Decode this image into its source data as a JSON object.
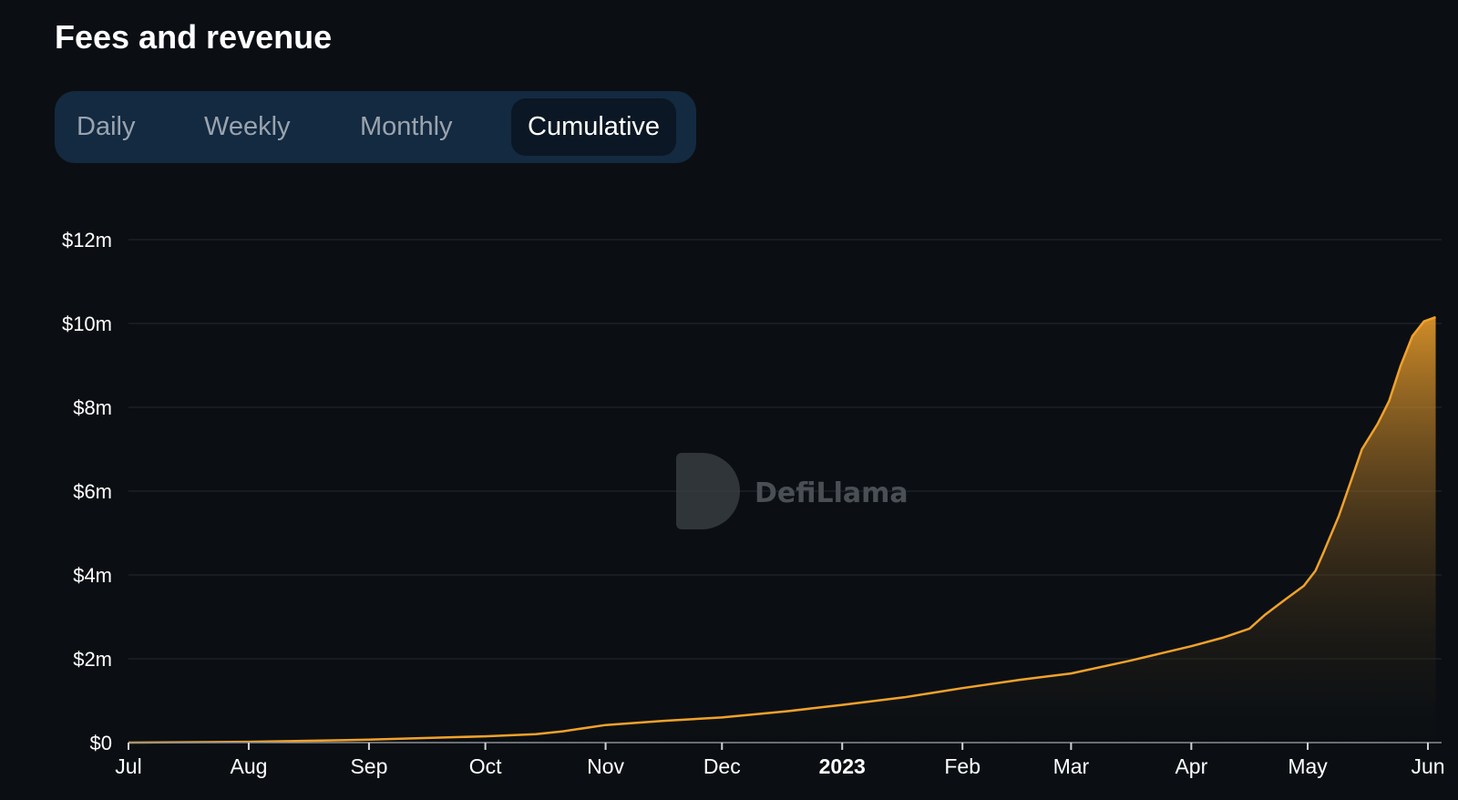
{
  "header": {
    "title": "Fees and revenue"
  },
  "tabs": [
    {
      "label": "Daily"
    },
    {
      "label": "Weekly"
    },
    {
      "label": "Monthly"
    },
    {
      "label": "Cumulative",
      "active": true
    }
  ],
  "watermark": "DefiLlama",
  "colors": {
    "line": "#f2a22b",
    "background": "#0b0f13",
    "tabs_bg": "#132a41"
  },
  "chart_data": {
    "type": "area",
    "title": "Fees and revenue",
    "series_mode": "Cumulative",
    "x_unit": "days since 2022-07-01",
    "y_unit": "USD millions",
    "ylim": [
      0,
      12
    ],
    "yticks": [
      {
        "v": 0,
        "label": "$0"
      },
      {
        "v": 2,
        "label": "$2m"
      },
      {
        "v": 4,
        "label": "$4m"
      },
      {
        "v": 6,
        "label": "$6m"
      },
      {
        "v": 8,
        "label": "$8m"
      },
      {
        "v": 10,
        "label": "$10m"
      },
      {
        "v": 12,
        "label": "$12m"
      }
    ],
    "xticks": [
      {
        "d": 0,
        "label": "Jul"
      },
      {
        "d": 31,
        "label": "Aug"
      },
      {
        "d": 62,
        "label": "Sep"
      },
      {
        "d": 92,
        "label": "Oct"
      },
      {
        "d": 123,
        "label": "Nov"
      },
      {
        "d": 153,
        "label": "Dec"
      },
      {
        "d": 184,
        "label": "2023",
        "bold": true
      },
      {
        "d": 215,
        "label": "Feb"
      },
      {
        "d": 243,
        "label": "Mar"
      },
      {
        "d": 274,
        "label": "Apr"
      },
      {
        "d": 304,
        "label": "May"
      },
      {
        "d": 335,
        "label": "Jun"
      }
    ],
    "grid": true,
    "points": [
      [
        0,
        0
      ],
      [
        31,
        0.02
      ],
      [
        62,
        0.07
      ],
      [
        92,
        0.15
      ],
      [
        105,
        0.2
      ],
      [
        112,
        0.27
      ],
      [
        123,
        0.42
      ],
      [
        138,
        0.52
      ],
      [
        153,
        0.6
      ],
      [
        170,
        0.75
      ],
      [
        184,
        0.9
      ],
      [
        200,
        1.08
      ],
      [
        215,
        1.3
      ],
      [
        230,
        1.5
      ],
      [
        243,
        1.65
      ],
      [
        258,
        1.95
      ],
      [
        274,
        2.3
      ],
      [
        282,
        2.5
      ],
      [
        289,
        2.72
      ],
      [
        293,
        3.05
      ],
      [
        298,
        3.4
      ],
      [
        303,
        3.74
      ],
      [
        306,
        4.1
      ],
      [
        308,
        4.52
      ],
      [
        312,
        5.4
      ],
      [
        315,
        6.2
      ],
      [
        318,
        7.0
      ],
      [
        322,
        7.6
      ],
      [
        325,
        8.15
      ],
      [
        328,
        9.0
      ],
      [
        331,
        9.7
      ],
      [
        334,
        10.05
      ],
      [
        337,
        10.15
      ]
    ]
  }
}
